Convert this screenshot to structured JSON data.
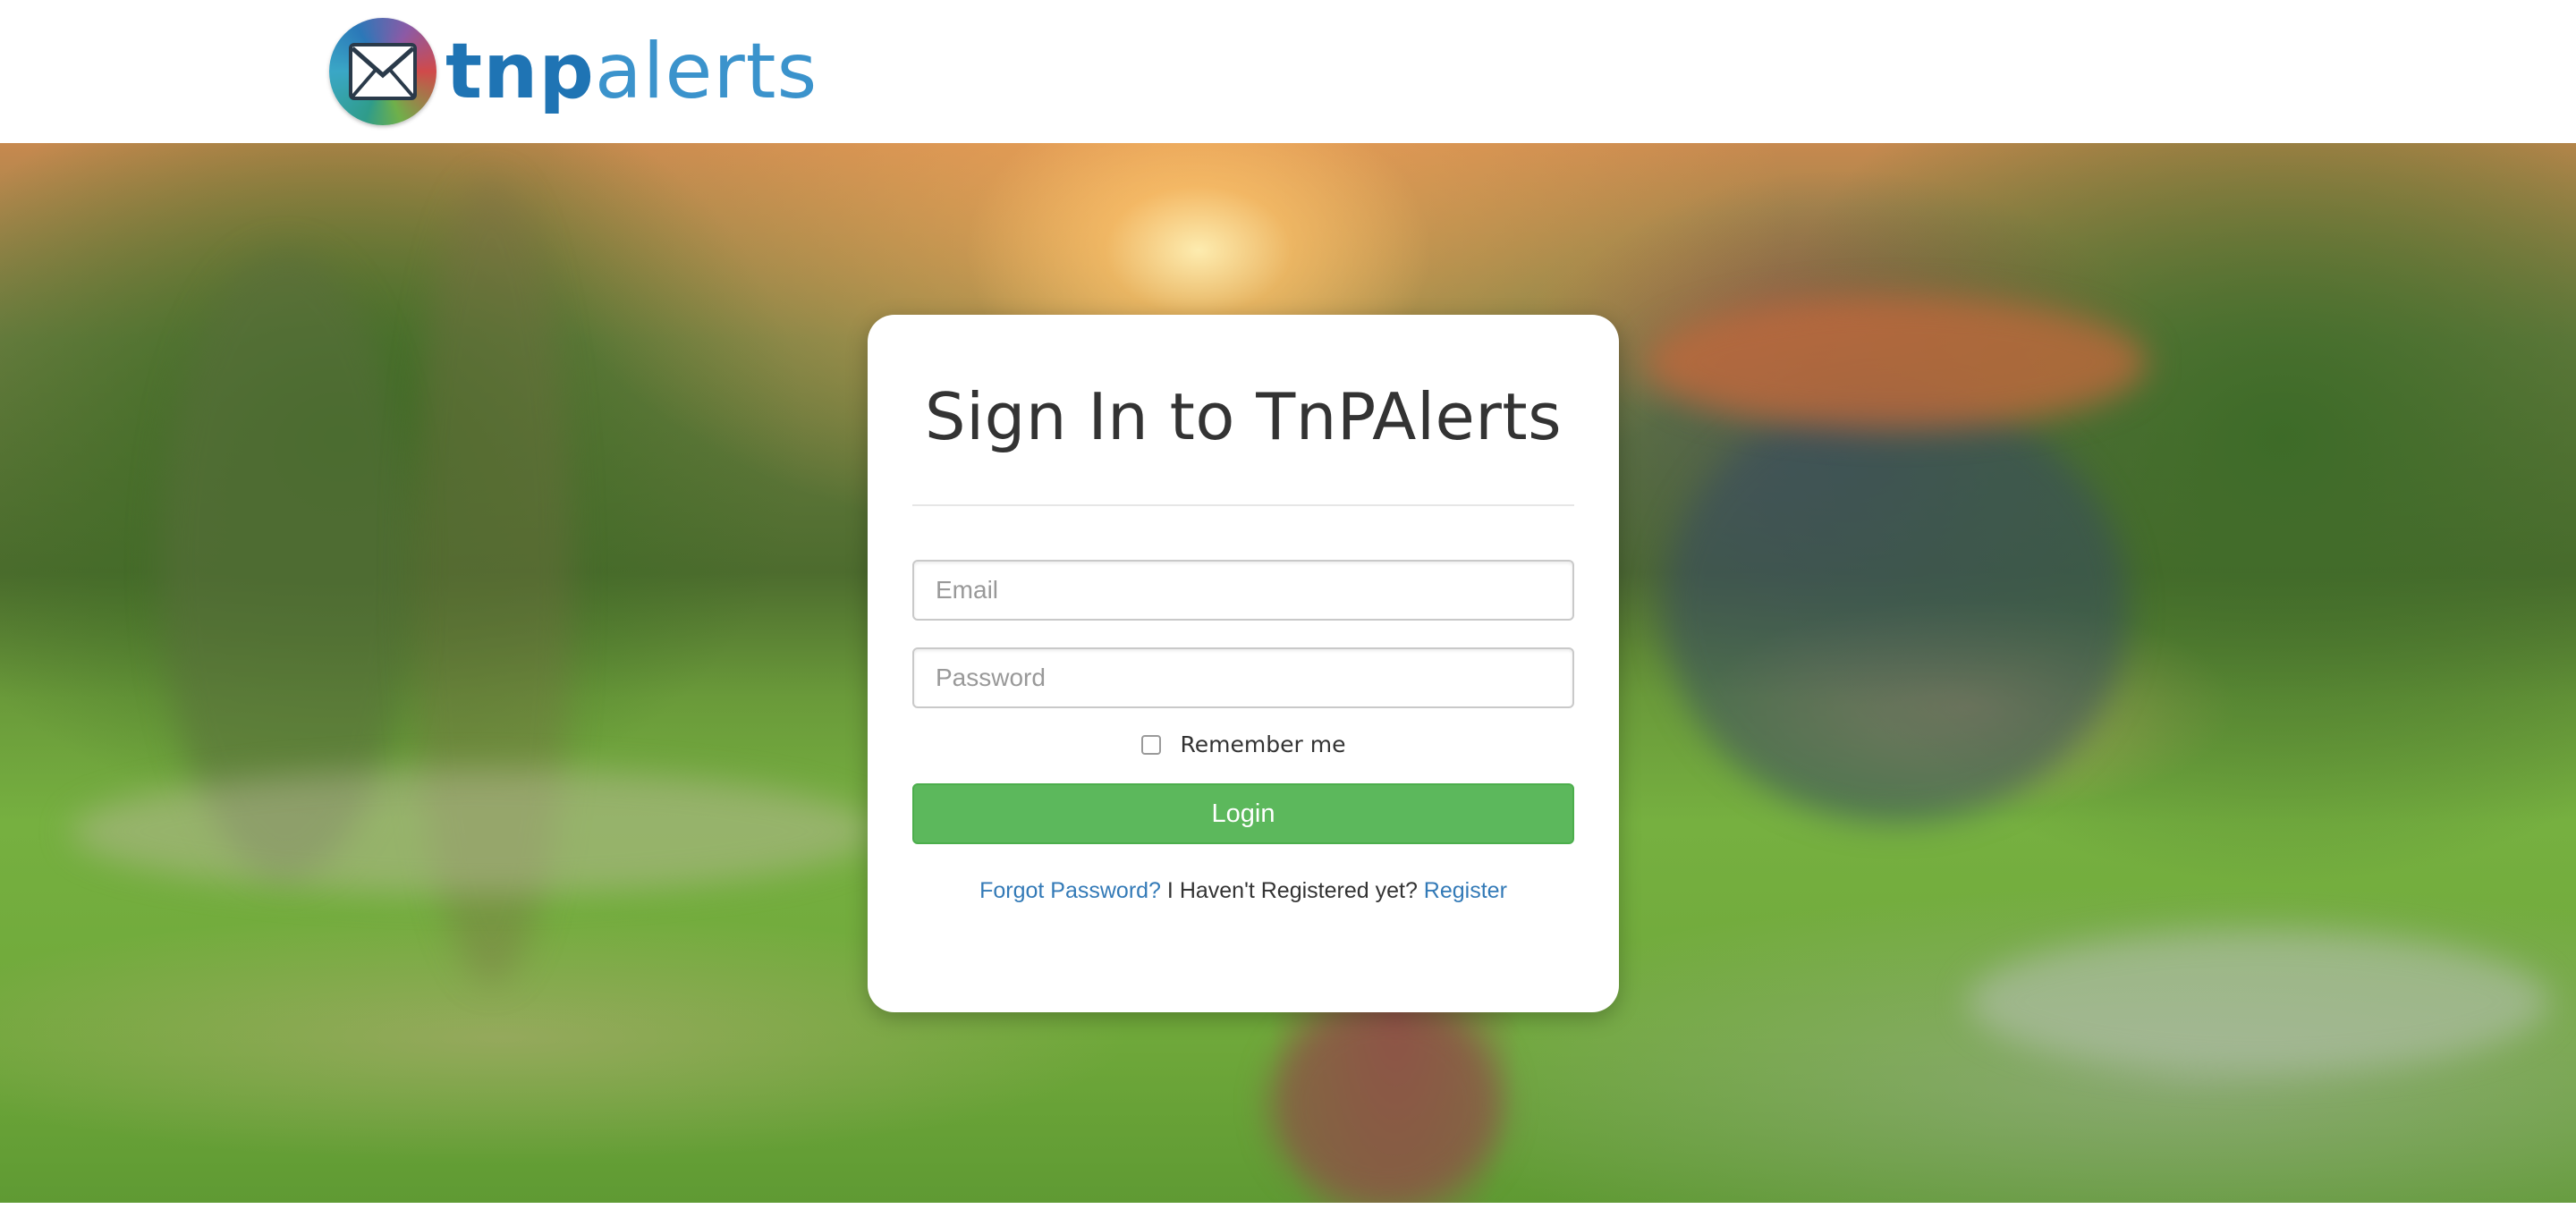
{
  "header": {
    "brand_part1": "tnp",
    "brand_part2": "alerts",
    "logo_icon": "envelope-icon"
  },
  "login_card": {
    "title": "Sign In to TnPAlerts",
    "email_placeholder": "Email",
    "email_value": "",
    "password_placeholder": "Password",
    "password_value": "",
    "remember_label": "Remember me",
    "remember_checked": false,
    "login_button": "Login",
    "forgot_link": "Forgot Password?",
    "register_prompt": "I Haven't Registered yet?",
    "register_link": "Register"
  },
  "colors": {
    "primary_button": "#5cb85c",
    "link": "#337ab7",
    "brand": "#2e86c1"
  }
}
